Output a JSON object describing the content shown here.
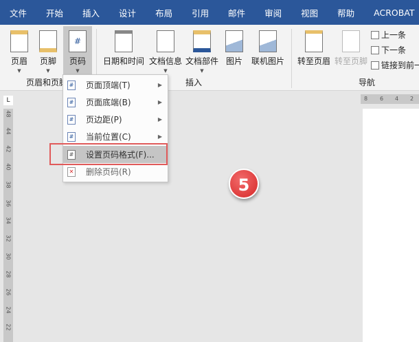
{
  "tabs": [
    "文件",
    "开始",
    "插入",
    "设计",
    "布局",
    "引用",
    "邮件",
    "审阅",
    "视图",
    "帮助",
    "ACROBAT"
  ],
  "ribbon": {
    "header_footer": {
      "buttons": [
        "页眉",
        "页脚",
        "页码"
      ],
      "group_label": "页眉和页脚"
    },
    "insert": {
      "buttons": [
        "日期和时间",
        "文档信息",
        "文档部件",
        "图片",
        "联机图片"
      ],
      "group_label": "插入"
    },
    "navigation": {
      "buttons": [
        "转至页眉",
        "转至页脚"
      ],
      "small": [
        "上一条",
        "下一条",
        "链接到前一"
      ],
      "group_label": "导航"
    }
  },
  "ruler": {
    "corner": "L",
    "vertical": [
      "48",
      "44",
      "42",
      "40",
      "38",
      "36",
      "34",
      "32",
      "30",
      "28",
      "26",
      "24",
      "22"
    ],
    "horizontal": [
      "8",
      "6",
      "4",
      "2"
    ]
  },
  "menu": {
    "items": [
      {
        "label": "页面顶端(T)",
        "submenu": true
      },
      {
        "label": "页面底端(B)",
        "submenu": true
      },
      {
        "label": "页边距(P)",
        "submenu": true
      },
      {
        "label": "当前位置(C)",
        "submenu": true
      },
      {
        "label": "设置页码格式(F)...",
        "submenu": false,
        "highlighted": true
      },
      {
        "label": "删除页码(R)",
        "submenu": false
      }
    ]
  },
  "step_badge": "5",
  "colors": {
    "tabbar": "#2b579a",
    "highlight": "#e05a5a",
    "badge": "#d62828"
  }
}
